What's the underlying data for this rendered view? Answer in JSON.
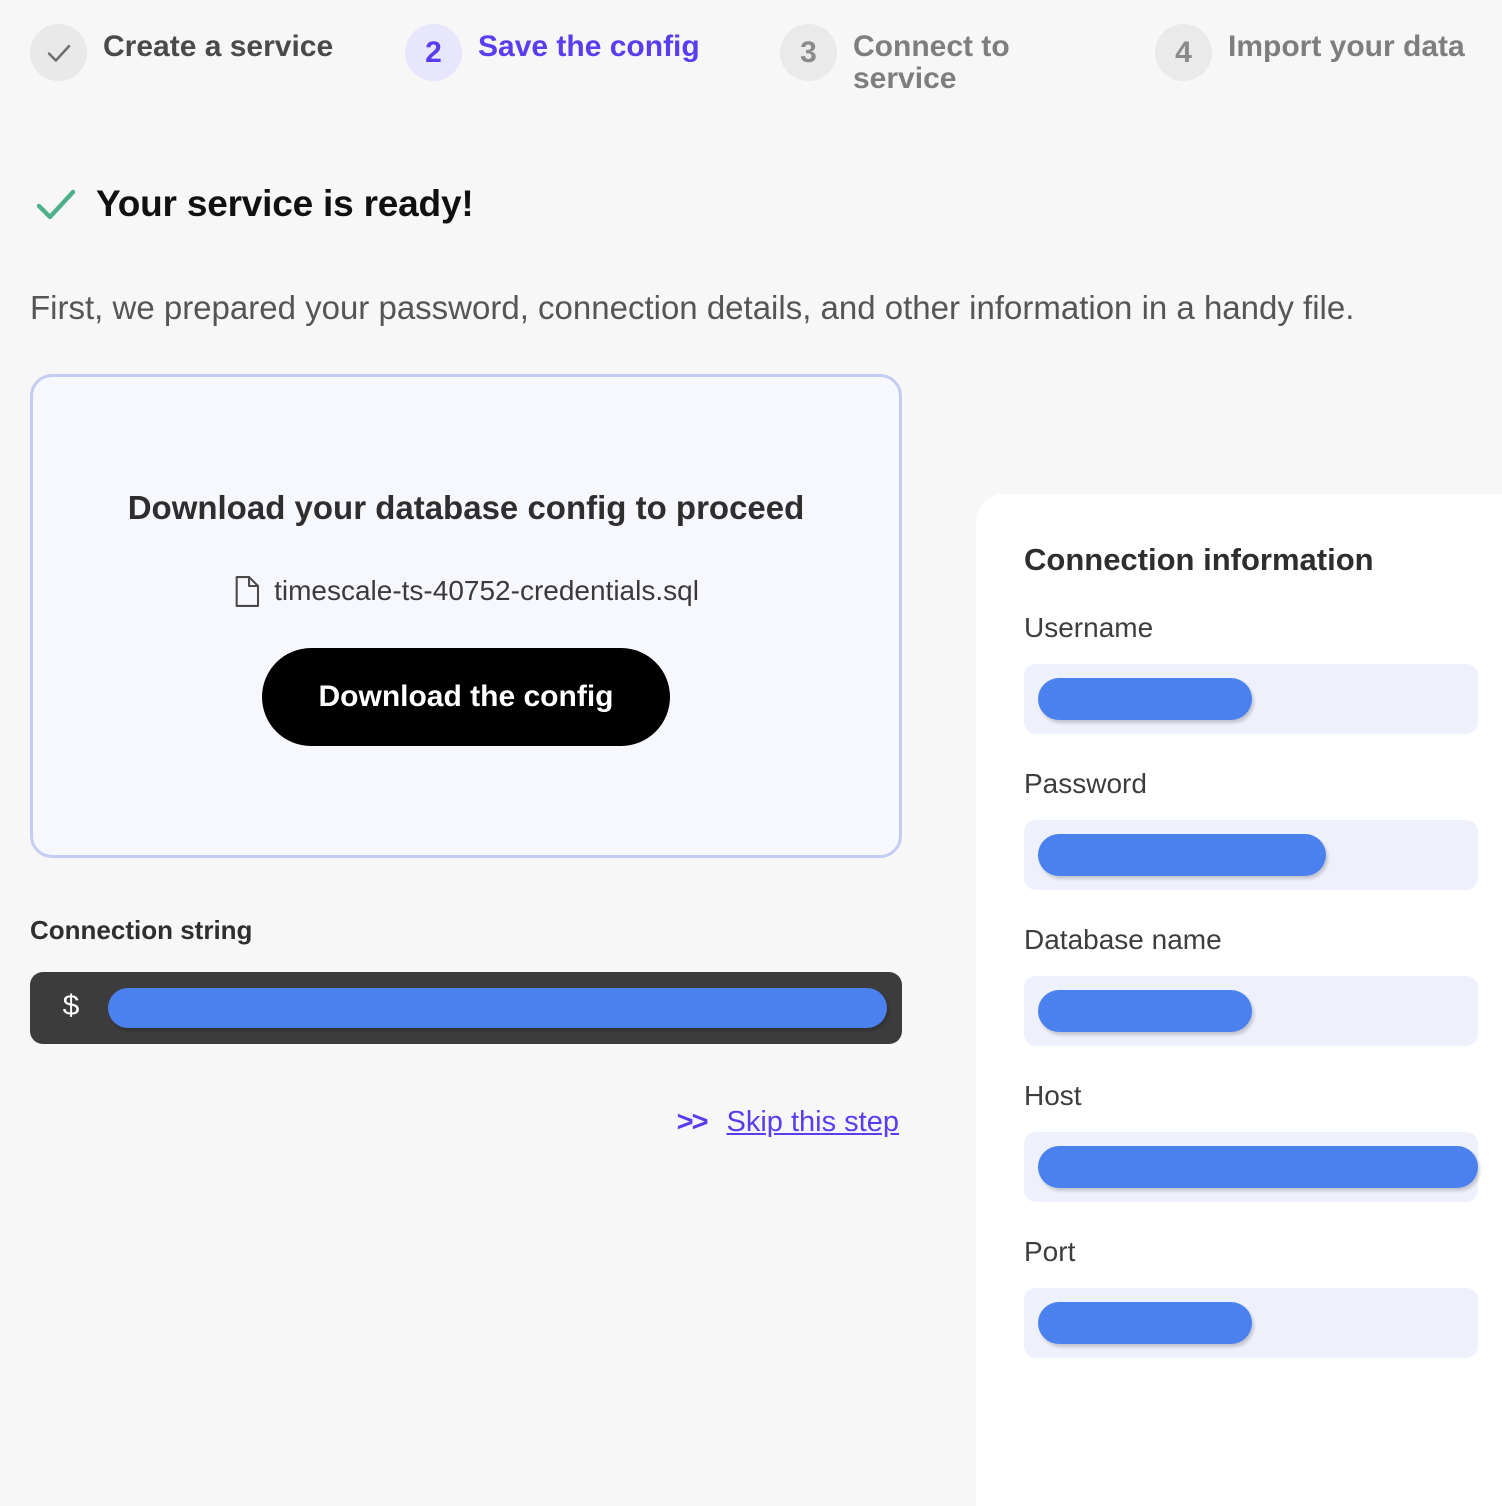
{
  "stepper": {
    "steps": [
      {
        "badge": "check",
        "label": "Create a service",
        "state": "done"
      },
      {
        "badge": "2",
        "label": "Save the config",
        "state": "active"
      },
      {
        "badge": "3",
        "label": "Connect to service",
        "state": "future"
      },
      {
        "badge": "4",
        "label": "Import your data",
        "state": "future"
      }
    ]
  },
  "ready": {
    "title": "Your service is ready!"
  },
  "intro": {
    "text": "First, we prepared your password, connection details, and other information in a handy file."
  },
  "download_card": {
    "title": "Download your database config to proceed",
    "file_name": "timescale-ts-40752-credentials.sql",
    "button_label": "Download the config"
  },
  "connection_string": {
    "label": "Connection string",
    "prompt": "$",
    "value_redacted": true,
    "value": ""
  },
  "skip": {
    "chevrons": ">>",
    "label": "Skip this step"
  },
  "connection_info": {
    "title": "Connection information",
    "fields": [
      {
        "label": "Username",
        "value": "",
        "redacted": true,
        "redact_width": 214
      },
      {
        "label": "Password",
        "value": "",
        "redacted": true,
        "redact_width": 288
      },
      {
        "label": "Database name",
        "value": "",
        "redacted": true,
        "redact_width": 214
      },
      {
        "label": "Host",
        "value": "",
        "redacted": true,
        "redact_width": 440
      },
      {
        "label": "Port",
        "value": "",
        "redacted": true,
        "redact_width": 214
      }
    ]
  },
  "colors": {
    "accent_purple": "#5a3dee",
    "redaction_blue": "#4a81ef",
    "success_green": "#4eb08a",
    "page_background": "#f7f7f7",
    "card_border": "#c3cdf3",
    "terminal_background": "#3c3c3c"
  }
}
